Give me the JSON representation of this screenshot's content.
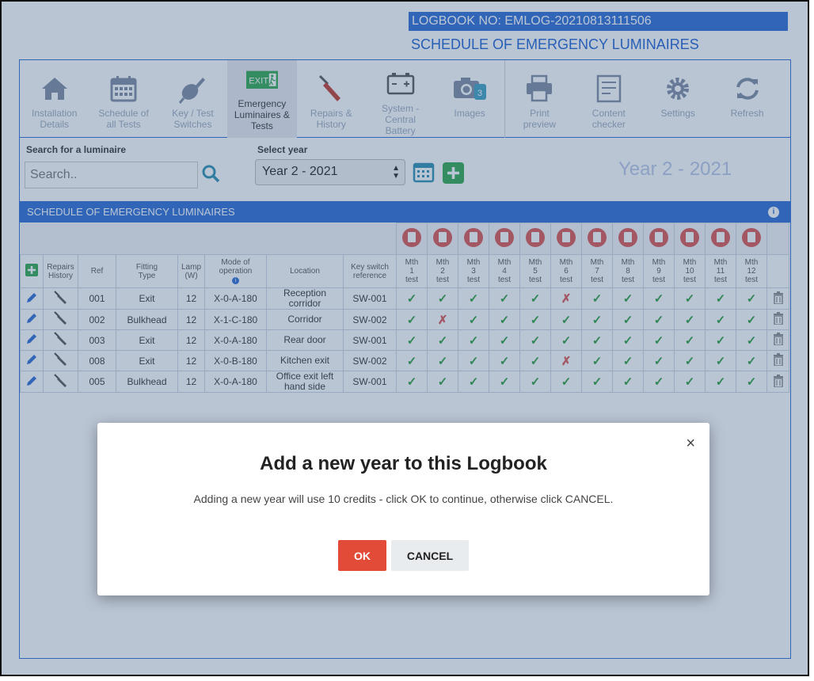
{
  "header": {
    "logbook_no": "LOGBOOK NO: EMLOG-20210813111506",
    "subtitle": "SCHEDULE OF EMERGENCY LUMINAIRES"
  },
  "toolbar": [
    {
      "label1": "Installation",
      "label2": "Details",
      "icon": "house-icon"
    },
    {
      "label1": "Schedule of",
      "label2": "all Tests",
      "icon": "calendar-icon"
    },
    {
      "label1": "Key / Test",
      "label2": "Switches",
      "icon": "key-switch-icon"
    },
    {
      "label1": "Emergency",
      "label2": "Luminaires &",
      "label3": "Tests",
      "icon": "exit-sign-icon"
    },
    {
      "label1": "Repairs &",
      "label2": "History",
      "icon": "screwdriver-icon"
    },
    {
      "label1": "System -",
      "label2": "Central",
      "label3": "Battery",
      "icon": "battery-icon"
    },
    {
      "label1": "Images",
      "icon": "camera-icon",
      "badge": "3"
    },
    {
      "label1": "Print",
      "label2": "preview",
      "icon": "printer-icon"
    },
    {
      "label1": "Content",
      "label2": "checker",
      "icon": "checklist-icon"
    },
    {
      "label1": "Settings",
      "icon": "gear-icon"
    },
    {
      "label1": "Refresh",
      "icon": "refresh-icon"
    }
  ],
  "search": {
    "label": "Search for a luminaire",
    "placeholder": "Search.."
  },
  "year": {
    "label": "Select year",
    "selected": "Year 2 - 2021",
    "display": "Year 2 - 2021"
  },
  "section_title": "SCHEDULE OF EMERGENCY LUMINAIRES",
  "table": {
    "headers": {
      "repairs": [
        "Repairs",
        "History"
      ],
      "ref": "Ref",
      "fitting": [
        "Fitting",
        "Type"
      ],
      "lamp": [
        "Lamp",
        "(W)"
      ],
      "mode": [
        "Mode of",
        "operation"
      ],
      "location": "Location",
      "keyswitch": [
        "Key switch",
        "reference"
      ],
      "months": [
        "1",
        "2",
        "3",
        "4",
        "5",
        "6",
        "7",
        "8",
        "9",
        "10",
        "11",
        "12"
      ],
      "mth": "Mth",
      "test": "test"
    },
    "rows": [
      {
        "ref": "001",
        "type": "Exit",
        "lamp": "12",
        "mode": "X-0-A-180",
        "location": "Reception corridor",
        "key": "SW-001",
        "tests": [
          1,
          1,
          1,
          1,
          1,
          0,
          1,
          1,
          1,
          1,
          1,
          1
        ]
      },
      {
        "ref": "002",
        "type": "Bulkhead",
        "lamp": "12",
        "mode": "X-1-C-180",
        "location": "Corridor",
        "key": "SW-002",
        "tests": [
          1,
          0,
          1,
          1,
          1,
          1,
          1,
          1,
          1,
          1,
          1,
          1
        ]
      },
      {
        "ref": "003",
        "type": "Exit",
        "lamp": "12",
        "mode": "X-0-A-180",
        "location": "Rear door",
        "key": "SW-001",
        "tests": [
          1,
          1,
          1,
          1,
          1,
          1,
          1,
          1,
          1,
          1,
          1,
          1
        ]
      },
      {
        "ref": "008",
        "type": "Exit",
        "lamp": "12",
        "mode": "X-0-B-180",
        "location": "Kitchen exit",
        "key": "SW-002",
        "tests": [
          1,
          1,
          1,
          1,
          1,
          0,
          1,
          1,
          1,
          1,
          1,
          1
        ]
      },
      {
        "ref": "005",
        "type": "Bulkhead",
        "lamp": "12",
        "mode": "X-0-A-180",
        "location": "Office exit left hand side",
        "key": "SW-001",
        "tests": [
          1,
          1,
          1,
          1,
          1,
          1,
          1,
          1,
          1,
          1,
          1,
          1
        ]
      }
    ]
  },
  "modal": {
    "title": "Add a new year to this Logbook",
    "message": "Adding a new year will use 10 credits - click OK to continue, otherwise click CANCEL.",
    "ok": "OK",
    "cancel": "CANCEL",
    "close": "×"
  }
}
